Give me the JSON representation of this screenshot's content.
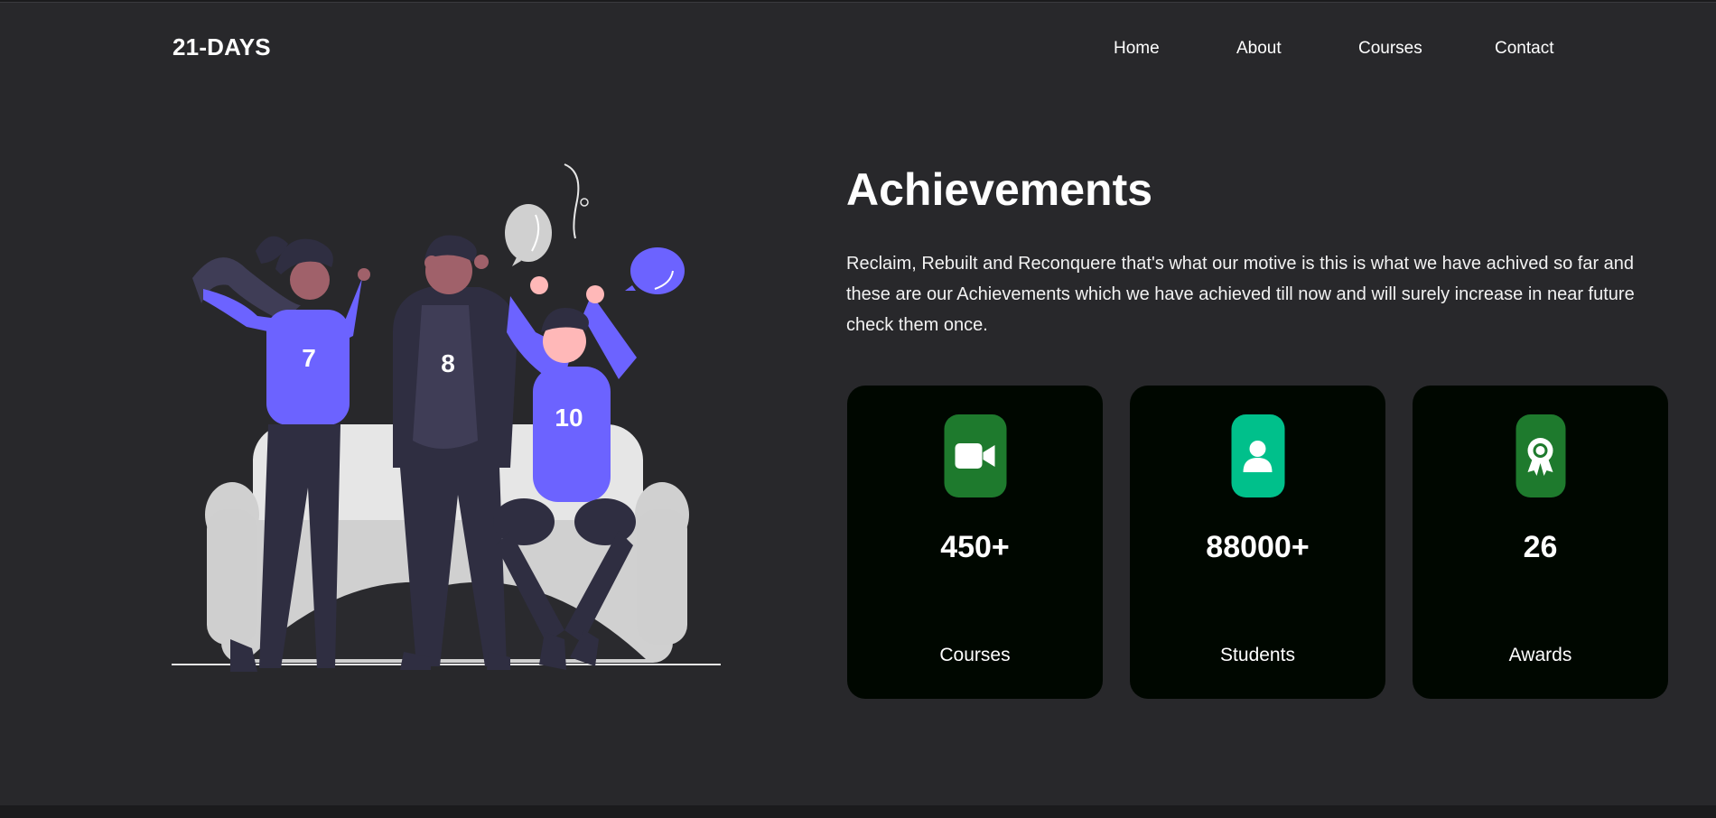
{
  "header": {
    "logo": "21-DAYS",
    "nav": [
      "Home",
      "About",
      "Courses",
      "Contact"
    ]
  },
  "hero": {
    "title": "Achievements",
    "description": "Reclaim, Rebuilt and Reconquere that's what our motive is this is what we have achived so far and these are our Achievements which we have achieved till now and will surely increase in near future check them once."
  },
  "illustration": {
    "jersey_numbers": [
      "7",
      "8",
      "10"
    ],
    "colors": {
      "accent": "#6c63ff",
      "dark": "#2f2e41",
      "sofa": "#e6e6e6"
    }
  },
  "stats": [
    {
      "value": "450+",
      "label": "Courses",
      "icon": "video-camera-icon",
      "icon_bg": "#1e7a2d"
    },
    {
      "value": "88000+",
      "label": "Students",
      "icon": "user-badge-icon",
      "icon_bg": "#00c08b"
    },
    {
      "value": "26",
      "label": "Awards",
      "icon": "award-ribbon-icon",
      "icon_bg": "#1e7a2d"
    }
  ]
}
